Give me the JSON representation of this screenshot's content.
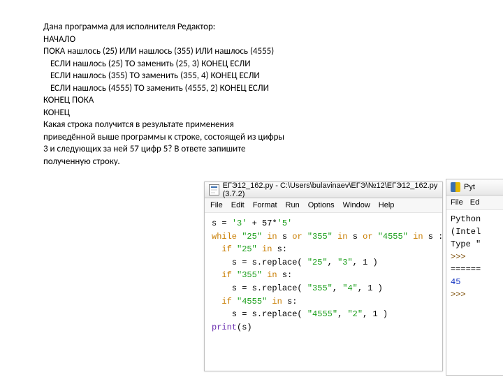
{
  "problem": {
    "l1": "Дана программа для исполнителя Редактор:",
    "l2": "НАЧАЛО",
    "l3": "ПОКА нашлось (25) ИЛИ нашлось (355) ИЛИ нашлось (4555)",
    "l4": "ЕСЛИ нашлось (25) ТО заменить (25, 3) КОНЕЦ ЕСЛИ",
    "l5": "ЕСЛИ нашлось (355) ТО заменить (355, 4) КОНЕЦ ЕСЛИ",
    "l6": "ЕСЛИ нашлось (4555) ТО заменить (4555, 2) КОНЕЦ ЕСЛИ",
    "l7": "КОНЕЦ ПОКА",
    "l8": "КОНЕЦ",
    "q1": "Какая строка получится в результате применения",
    "q2": "приведённой выше программы к строке, состоящей из цифры",
    "q3": "3 и следующих за ней 57 цифр 5? В ответе запишите",
    "q4": "полученную строку."
  },
  "editor": {
    "title": "ЕГЭ12_162.py - C:\\Users\\bulavinaev\\ЕГЭ\\№12\\ЕГЭ12_162.py (3.7.2)",
    "menu": {
      "file": "File",
      "edit": "Edit",
      "format": "Format",
      "run": "Run",
      "options": "Options",
      "window": "Window",
      "help": "Help"
    },
    "code": {
      "s_assign_1": "s = ",
      "s_str1": "'3'",
      "s_plus": " + ",
      "s_num": "57",
      "s_mul": "*",
      "s_str2": "'5'",
      "while_kw": "while ",
      "q25": "\"25\"",
      "in_kw": " in ",
      "s_var": "s",
      "or_kw": " or ",
      "q355": "\"355\"",
      "q4555": "\"4555\"",
      "colon": " :",
      "if_kw": "if ",
      "colon2": ":",
      "repl_open": "s = s.replace( ",
      "comma": ", ",
      "q3": "\"3\"",
      "one": "1",
      "close": " )",
      "q4": "\"4\"",
      "q2": "\"2\"",
      "print_kw": "print",
      "paren_s": "(s)"
    }
  },
  "shell": {
    "title": "Pyt",
    "menu": {
      "file": "File",
      "edit": "Ed"
    },
    "l1": "Python",
    "l2": "(Intel",
    "l3": "Type \"",
    "prompt": ">>> ",
    "restart": "======",
    "out": "45"
  }
}
